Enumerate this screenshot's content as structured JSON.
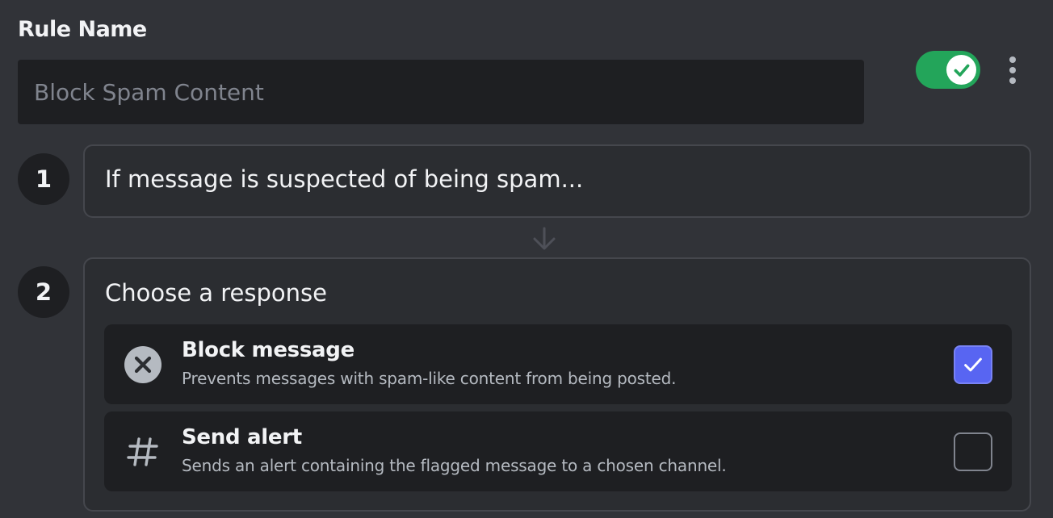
{
  "rule": {
    "title": "Rule Name",
    "name_placeholder": "Block Spam Content",
    "name_value": "",
    "enabled": true
  },
  "steps": [
    {
      "number": "1",
      "text": "If message is suspected of being spam..."
    },
    {
      "number": "2",
      "title": "Choose a response",
      "options": [
        {
          "title": "Block message",
          "description": "Prevents messages with spam-like content from being posted.",
          "icon": "circle-x-icon",
          "checked": true
        },
        {
          "title": "Send alert",
          "description": "Sends an alert containing the flagged message to a chosen channel.",
          "icon": "hash-icon",
          "checked": false
        }
      ]
    }
  ],
  "colors": {
    "background": "#313338",
    "input_bg": "#1e1f22",
    "toggle_on": "#23a55a",
    "checkbox_accent": "#5865f2"
  }
}
